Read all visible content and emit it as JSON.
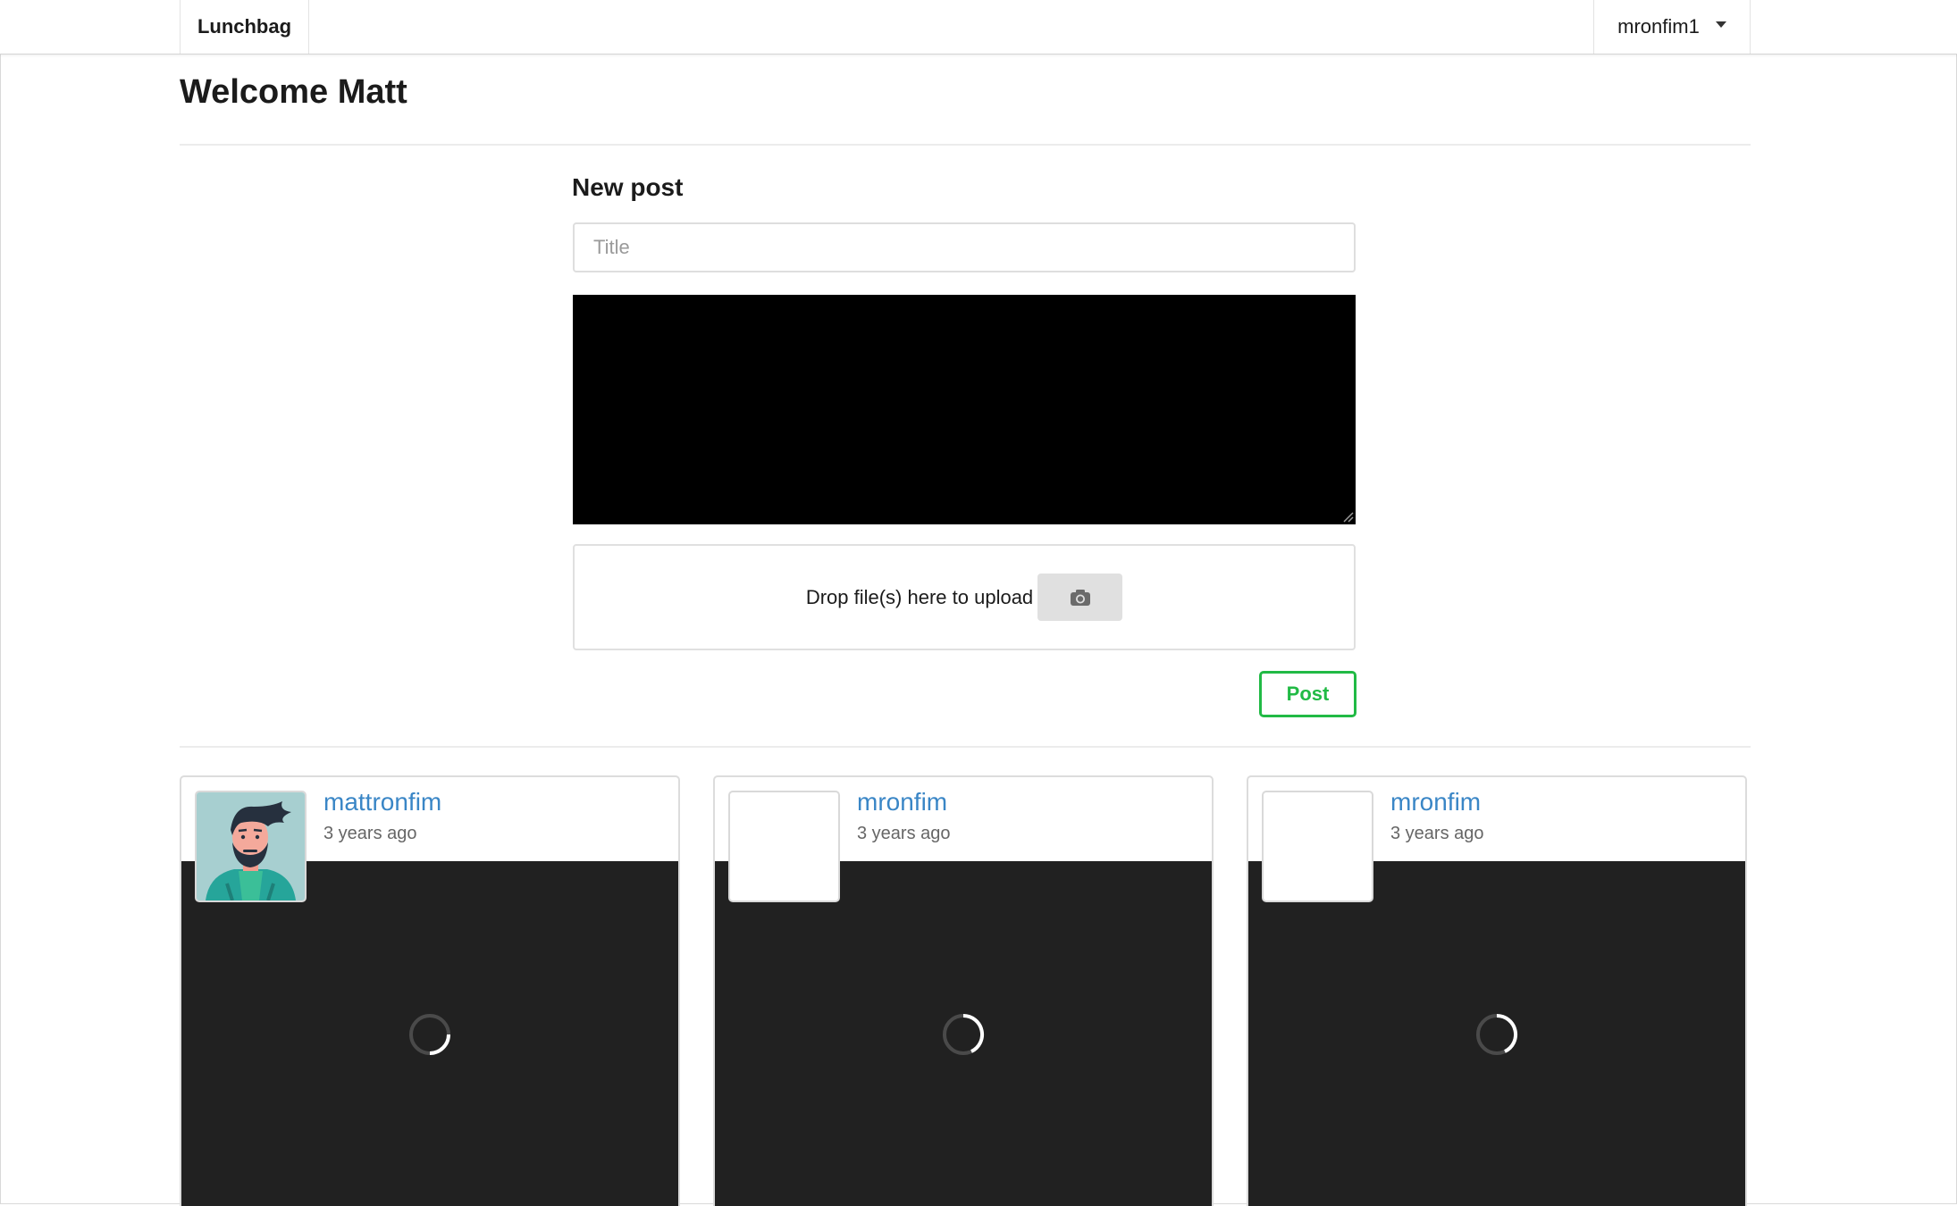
{
  "navbar": {
    "brand": "Lunchbag",
    "username": "mronfim1"
  },
  "header": {
    "welcome": "Welcome Matt"
  },
  "new_post": {
    "heading": "New post",
    "title_placeholder": "Title",
    "title_value": "",
    "dropzone_text": "Drop file(s) here to upload",
    "camera_icon": "camera-icon",
    "post_label": "Post"
  },
  "colors": {
    "accent_green": "#21ba45",
    "link_blue": "#3a86c6",
    "media_background": "#212121",
    "editor_background": "#000000"
  },
  "feed": {
    "posts": [
      {
        "username": "mattronfim",
        "time": "3 years ago",
        "avatar": "bearded-man-avatar"
      },
      {
        "username": "mronfim",
        "time": "3 years ago",
        "avatar": "blank-avatar"
      },
      {
        "username": "mronfim",
        "time": "3 years ago",
        "avatar": "blank-avatar"
      }
    ]
  }
}
